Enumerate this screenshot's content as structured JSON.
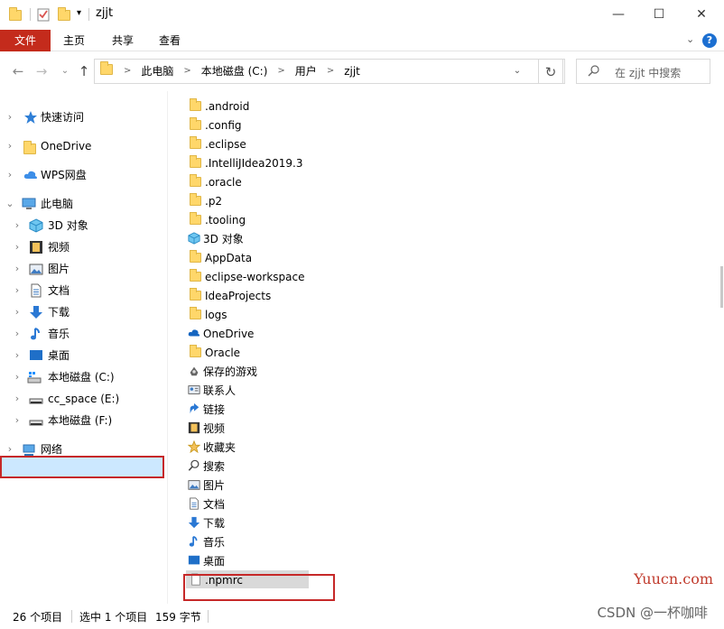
{
  "window": {
    "title": "zjjt",
    "controls": {
      "minimize": "—",
      "maximize": "☐",
      "close": "✕"
    }
  },
  "ribbon": {
    "tabs": [
      "文件",
      "主页",
      "共享",
      "查看"
    ],
    "expand_icon": "chevron-down-icon",
    "help_label": "?"
  },
  "navigation": {
    "breadcrumbs": [
      "此电脑",
      "本地磁盘 (C:)",
      "用户",
      "zjjt"
    ],
    "search_placeholder": "在 zjjt 中搜索"
  },
  "sidebar": {
    "items": [
      {
        "label": "快速访问",
        "icon": "star-icon"
      },
      {
        "label": "OneDrive",
        "icon": "folder-icon"
      },
      {
        "label": "WPS网盘",
        "icon": "cloud-icon"
      },
      {
        "label": "此电脑",
        "icon": "computer-icon",
        "expanded": true
      },
      {
        "label": "3D 对象",
        "icon": "cube-icon"
      },
      {
        "label": "视频",
        "icon": "video-icon"
      },
      {
        "label": "图片",
        "icon": "picture-icon"
      },
      {
        "label": "文档",
        "icon": "document-icon"
      },
      {
        "label": "下载",
        "icon": "download-icon"
      },
      {
        "label": "音乐",
        "icon": "music-icon"
      },
      {
        "label": "桌面",
        "icon": "desktop-icon"
      },
      {
        "label": "本地磁盘 (C:)",
        "icon": "drive-icon",
        "selected": true
      },
      {
        "label": "cc_space (E:)",
        "icon": "drive-icon"
      },
      {
        "label": "本地磁盘 (F:)",
        "icon": "drive-icon"
      },
      {
        "label": "网络",
        "icon": "network-icon"
      }
    ]
  },
  "files": [
    {
      "name": ".android",
      "icon": "folder-icon"
    },
    {
      "name": ".config",
      "icon": "folder-icon"
    },
    {
      "name": ".eclipse",
      "icon": "folder-icon"
    },
    {
      "name": ".IntelliJIdea2019.3",
      "icon": "folder-icon"
    },
    {
      "name": ".oracle",
      "icon": "folder-icon"
    },
    {
      "name": ".p2",
      "icon": "folder-icon"
    },
    {
      "name": ".tooling",
      "icon": "folder-icon"
    },
    {
      "name": "3D 对象",
      "icon": "cube-icon"
    },
    {
      "name": "AppData",
      "icon": "folder-icon"
    },
    {
      "name": "eclipse-workspace",
      "icon": "folder-icon"
    },
    {
      "name": "IdeaProjects",
      "icon": "folder-icon"
    },
    {
      "name": "logs",
      "icon": "folder-icon"
    },
    {
      "name": "OneDrive",
      "icon": "cloud-icon"
    },
    {
      "name": "Oracle",
      "icon": "folder-icon"
    },
    {
      "name": "保存的游戏",
      "icon": "game-icon"
    },
    {
      "name": "联系人",
      "icon": "contacts-icon"
    },
    {
      "name": "链接",
      "icon": "link-icon"
    },
    {
      "name": "视频",
      "icon": "video-icon"
    },
    {
      "name": "收藏夹",
      "icon": "star-icon"
    },
    {
      "name": "搜索",
      "icon": "search-icon"
    },
    {
      "name": "图片",
      "icon": "picture-icon"
    },
    {
      "name": "文档",
      "icon": "document-icon"
    },
    {
      "name": "下载",
      "icon": "download-icon"
    },
    {
      "name": "音乐",
      "icon": "music-icon"
    },
    {
      "name": "桌面",
      "icon": "desktop-icon"
    },
    {
      "name": ".npmrc",
      "icon": "file-icon",
      "selected": true
    }
  ],
  "status": {
    "item_count": "26 个项目",
    "selection": "选中 1 个项目",
    "size": "159 字节"
  },
  "watermarks": {
    "site": "Yuucn.com",
    "author": "CSDN @一杯咖啡"
  },
  "colors": {
    "file_tab": "#c42b1c",
    "selection": "#cce8ff",
    "highlight_box": "#c62828",
    "folder": "#ffd76a"
  }
}
